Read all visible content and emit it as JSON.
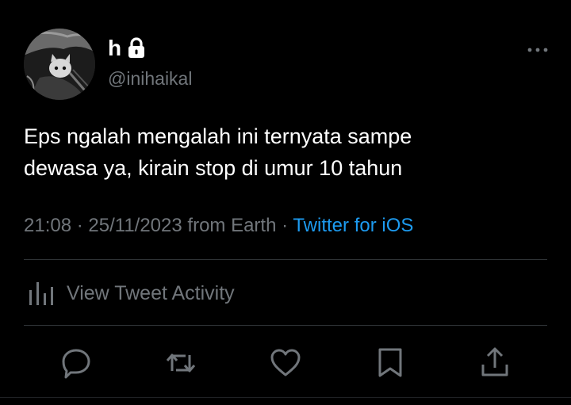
{
  "user": {
    "display_name": "h",
    "handle": "@inihaikal",
    "avatar_icon": "cat-photo-avatar",
    "protected_icon": "lock-icon"
  },
  "tweet": {
    "text_line1": "Eps ngalah mengalah ini ternyata sampe",
    "text_line2": "dewasa ya, kirain stop di umur 10 tahun",
    "time": "21:08",
    "separator": " · ",
    "date": "25/11/2023",
    "location": " from Earth",
    "separator2": " · ",
    "source": "Twitter for iOS"
  },
  "activity": {
    "label": "View Tweet Activity",
    "icon": "analytics-bars-icon"
  },
  "actions": {
    "reply_icon": "reply-icon",
    "retweet_icon": "retweet-icon",
    "like_icon": "heart-icon",
    "bookmark_icon": "bookmark-icon",
    "share_icon": "share-icon"
  },
  "colors": {
    "background": "#000000",
    "text": "#ffffff",
    "muted": "#71767b",
    "link": "#1d9bf0",
    "divider": "#2f3336"
  }
}
